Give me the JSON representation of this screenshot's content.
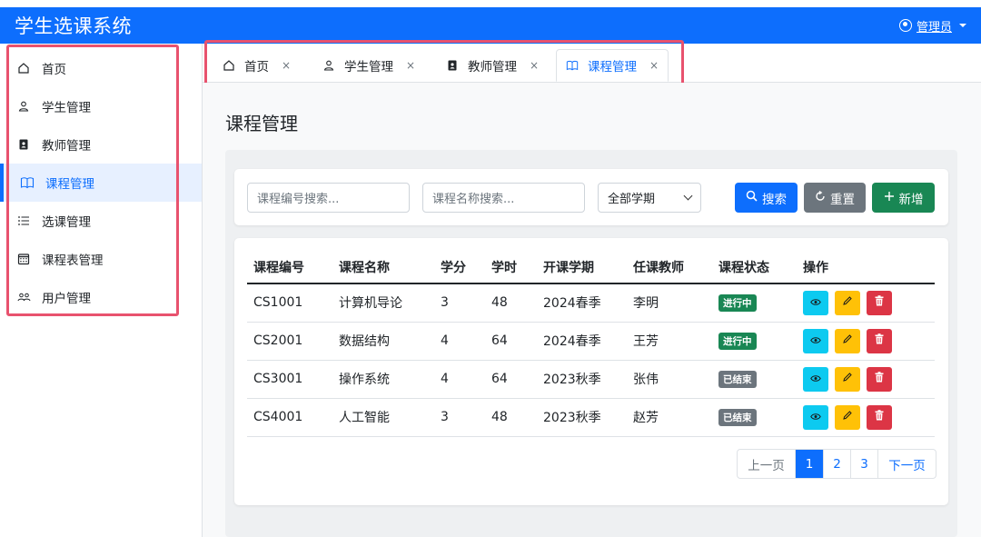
{
  "app": {
    "title": "学生选课系统",
    "user": "管理员"
  },
  "sidebar": {
    "items": [
      {
        "label": "首页",
        "icon": "home-icon"
      },
      {
        "label": "学生管理",
        "icon": "person-icon"
      },
      {
        "label": "教师管理",
        "icon": "badge-icon"
      },
      {
        "label": "课程管理",
        "icon": "book-icon",
        "active": true
      },
      {
        "label": "选课管理",
        "icon": "list-icon"
      },
      {
        "label": "课程表管理",
        "icon": "calendar-icon"
      },
      {
        "label": "用户管理",
        "icon": "people-icon"
      }
    ]
  },
  "tabs": [
    {
      "label": "首页",
      "close": "×"
    },
    {
      "label": "学生管理",
      "close": "×"
    },
    {
      "label": "教师管理",
      "close": "×"
    },
    {
      "label": "课程管理",
      "close": "×",
      "active": true
    }
  ],
  "main": {
    "title": "课程管理",
    "search": {
      "code_placeholder": "课程编号搜索...",
      "name_placeholder": "课程名称搜索...",
      "semester_selected": "全部学期",
      "search_label": "搜索",
      "reset_label": "重置",
      "add_label": "新增"
    },
    "table": {
      "headers": [
        "课程编号",
        "课程名称",
        "学分",
        "学时",
        "开课学期",
        "任课教师",
        "课程状态",
        "操作"
      ],
      "rows": [
        {
          "code": "CS1001",
          "name": "计算机导论",
          "credit": "3",
          "hours": "48",
          "semester": "2024春季",
          "teacher": "李明",
          "status": "进行中"
        },
        {
          "code": "CS2001",
          "name": "数据结构",
          "credit": "4",
          "hours": "64",
          "semester": "2024春季",
          "teacher": "王芳",
          "status": "进行中"
        },
        {
          "code": "CS3001",
          "name": "操作系统",
          "credit": "4",
          "hours": "64",
          "semester": "2023秋季",
          "teacher": "张伟",
          "status": "已结束"
        },
        {
          "code": "CS4001",
          "name": "人工智能",
          "credit": "3",
          "hours": "48",
          "semester": "2023秋季",
          "teacher": "赵芳",
          "status": "已结束"
        }
      ]
    },
    "pagination": {
      "prev": "上一页",
      "pages": [
        "1",
        "2",
        "3"
      ],
      "current": "1",
      "next": "下一页"
    }
  },
  "colors": {
    "primary": "#0d6efd",
    "status_active": "#198754",
    "status_ended": "#6c757d",
    "highlight": "#e8526e"
  }
}
